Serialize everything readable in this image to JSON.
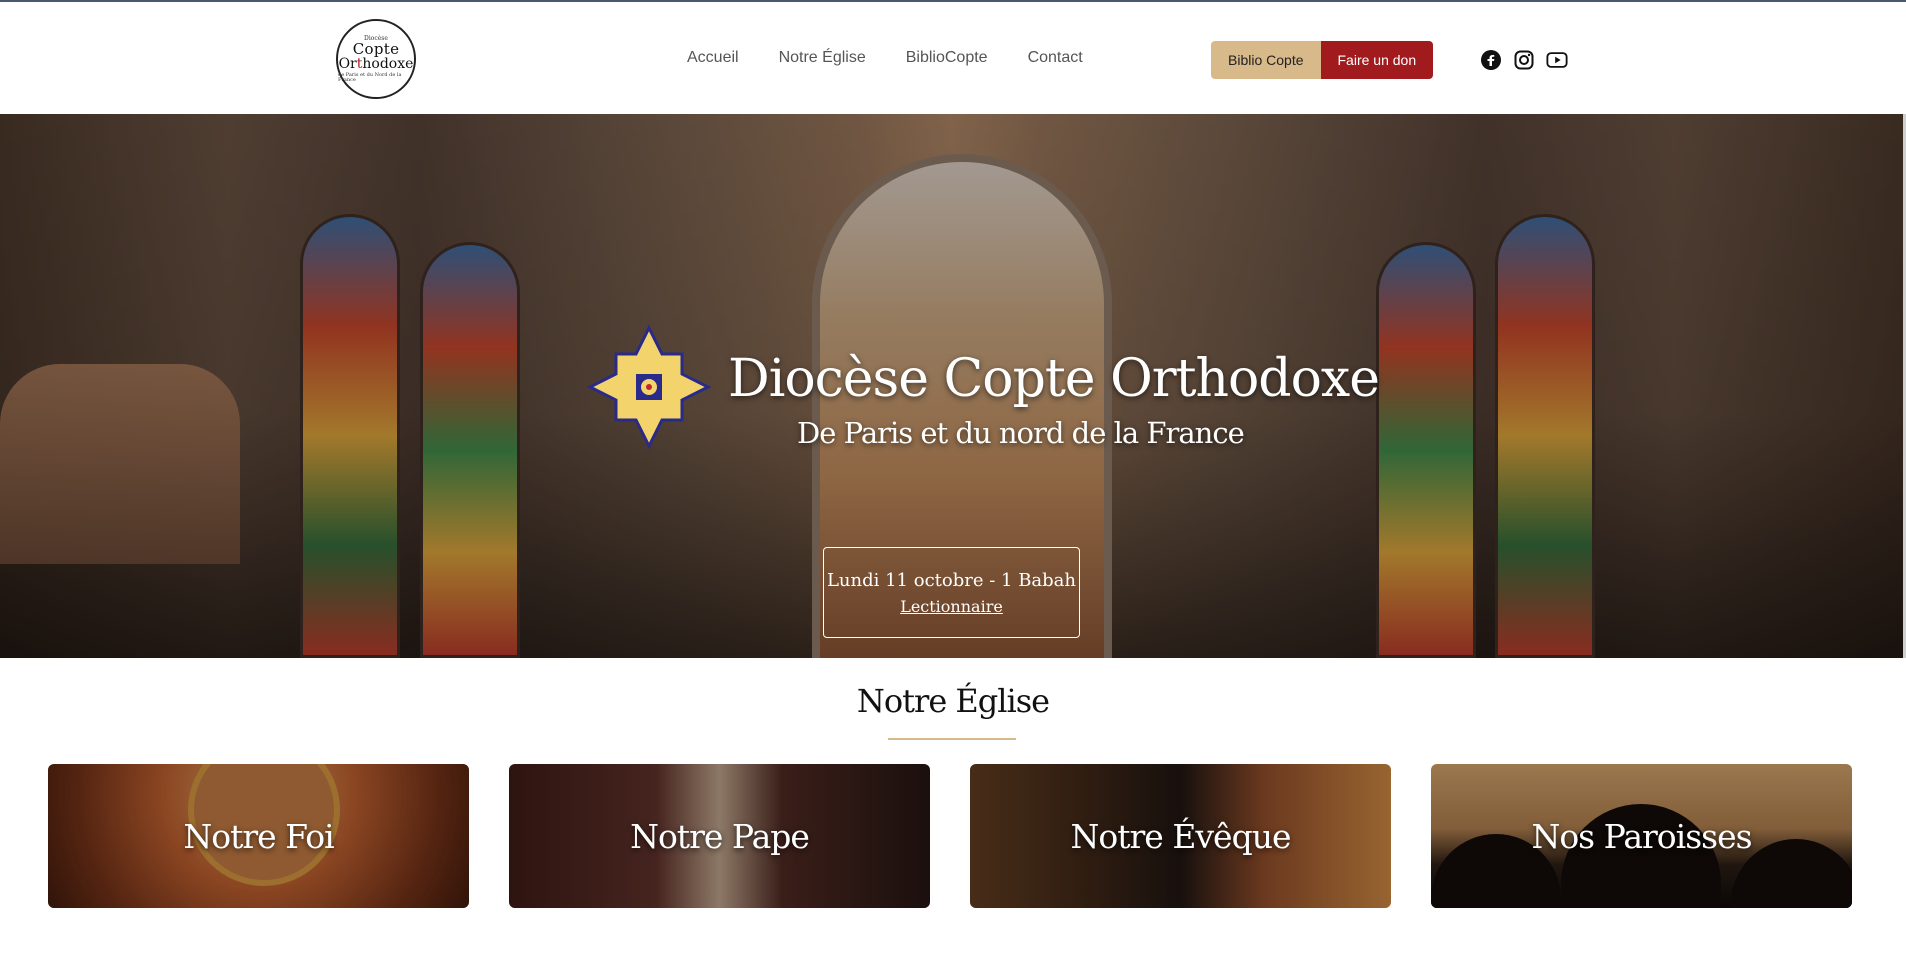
{
  "header": {
    "logo": {
      "line1": "Diocèse",
      "line2": "Copte",
      "line3a": "Or",
      "line3b": "t",
      "line3c": "hodoxe",
      "line4": "de Paris et du Nord de la France"
    },
    "nav": [
      {
        "label": "Accueil"
      },
      {
        "label": "Notre Église"
      },
      {
        "label": "BiblioCopte"
      },
      {
        "label": "Contact"
      }
    ],
    "buttons": {
      "biblio": "Biblio Copte",
      "don": "Faire un don"
    },
    "socials": [
      "facebook-icon",
      "instagram-icon",
      "youtube-icon"
    ]
  },
  "hero": {
    "title": "Diocèse Copte Orthodoxe",
    "subtitle": "De Paris et du nord de la France",
    "date": "Lundi 11 octobre - 1 Babah",
    "link": "Lectionnaire"
  },
  "section": {
    "title": "Notre Église",
    "cards": [
      {
        "label": "Notre Foi"
      },
      {
        "label": "Notre Pape"
      },
      {
        "label": "Notre Évêque"
      },
      {
        "label": "Nos Paroisses"
      }
    ]
  },
  "colors": {
    "accent_gold": "#d7b98a",
    "accent_red": "#a11a1d",
    "nav_text": "#555555"
  }
}
